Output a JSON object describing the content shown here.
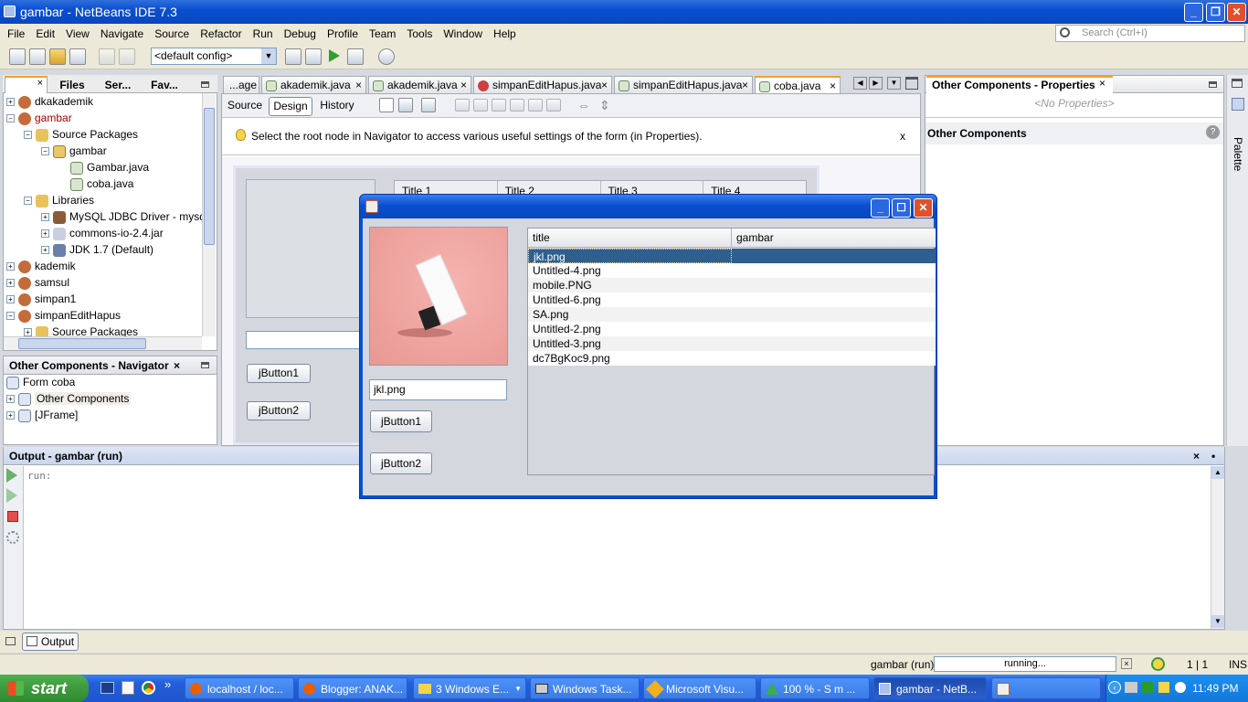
{
  "window": {
    "title": "gambar - NetBeans IDE 7.3"
  },
  "menu": [
    "File",
    "Edit",
    "View",
    "Navigate",
    "Source",
    "Refactor",
    "Run",
    "Debug",
    "Profile",
    "Team",
    "Tools",
    "Window",
    "Help"
  ],
  "toolbar": {
    "config": "<default config>",
    "search_placeholder": "Search (Ctrl+I)"
  },
  "projects": {
    "tabs": [
      "Files",
      "Ser...",
      "Fav..."
    ],
    "tree": [
      {
        "label": "dkakademik",
        "level": 0
      },
      {
        "label": "gambar",
        "level": 0
      },
      {
        "label": "Source Packages",
        "level": 1
      },
      {
        "label": "gambar",
        "level": 2
      },
      {
        "label": "Gambar.java",
        "level": 3
      },
      {
        "label": "coba.java",
        "level": 3
      },
      {
        "label": "Libraries",
        "level": 1
      },
      {
        "label": "MySQL JDBC Driver - mysql-",
        "level": 2
      },
      {
        "label": "commons-io-2.4.jar",
        "level": 2
      },
      {
        "label": "JDK 1.7 (Default)",
        "level": 2
      },
      {
        "label": "kademik",
        "level": 0
      },
      {
        "label": "samsul",
        "level": 0
      },
      {
        "label": "simpan1",
        "level": 0
      },
      {
        "label": "simpanEditHapus",
        "level": 0
      },
      {
        "label": "Source Packages",
        "level": 1
      }
    ]
  },
  "navigator": {
    "title": "Other Components - Navigator",
    "items": [
      "Form coba",
      "Other Components",
      "[JFrame]"
    ]
  },
  "editor": {
    "tabs": [
      "...age",
      "akademik.java",
      "akademik.java",
      "simpanEditHapus.java",
      "simpanEditHapus.java",
      "coba.java"
    ],
    "modes": [
      "Source",
      "Design",
      "History"
    ],
    "hint": "Select the root node in Navigator to access various useful settings of the form (in Properties).",
    "hint_close": "x",
    "design_columns": [
      "Title 1",
      "Title 2",
      "Title 3",
      "Title 4"
    ],
    "design_button1": "jButton1",
    "design_button2": "jButton2"
  },
  "properties": {
    "title": "Other Components - Properties",
    "no_props": "<No Properties>",
    "section": "Other Components",
    "palette": "Palette"
  },
  "dialog": {
    "text_value": "jkl.png",
    "button1": "jButton1",
    "button2": "jButton2",
    "columns": [
      "title",
      "gambar"
    ],
    "rows": [
      "jkl.png",
      "Untitled-4.png",
      "mobile.PNG",
      "Untitled-6.png",
      "SA.png",
      "Untitled-2.png",
      "Untitled-3.png",
      "dc7BgKoc9.png"
    ]
  },
  "output": {
    "title": "Output - gambar (run)",
    "text": "run:",
    "tab": "Output"
  },
  "status": {
    "task": "gambar (run)",
    "progress_text": "running...",
    "position": "1 | 1",
    "mode": "INS"
  },
  "taskbar": {
    "start": "start",
    "items": [
      "localhost / loc...",
      "Blogger: ANAK...",
      "3 Windows E...",
      "Windows Task...",
      "Microsoft Visu...",
      "100 % - S  m  ...",
      "gambar - NetB..."
    ],
    "clock": "11:49 PM"
  },
  "colors": {
    "titlebar": "#0a4fd0",
    "selection": "#2f5f8f",
    "taskbar": "#245edb",
    "start": "#3c9a3c"
  }
}
